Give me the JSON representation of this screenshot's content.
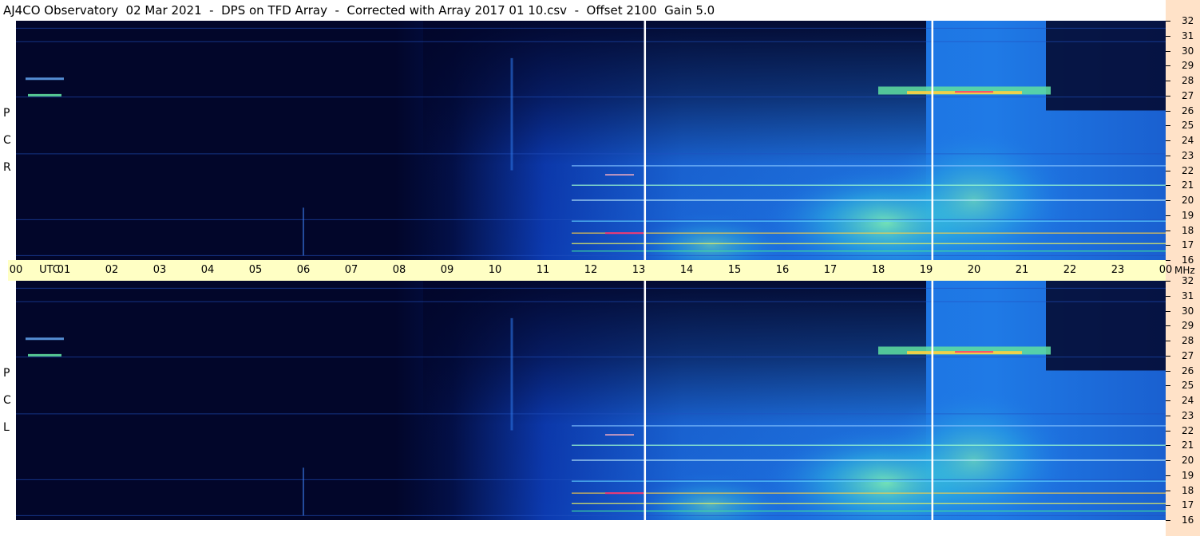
{
  "title": "AJ4CO Observatory  02 Mar 2021  -  DPS on TFD Array  -  Corrected with Array 2017 01 10.csv  -  Offset 2100  Gain 5.0",
  "chart_data": {
    "type": "heatmap",
    "panels": [
      {
        "name": "RCP",
        "polarization_letters": [
          "R",
          "C",
          "P"
        ]
      },
      {
        "name": "LCP",
        "polarization_letters": [
          "L",
          "C",
          "P"
        ]
      }
    ],
    "x_axis": {
      "labels": [
        "00",
        "UTC",
        "01",
        "02",
        "03",
        "04",
        "05",
        "06",
        "07",
        "08",
        "09",
        "10",
        "11",
        "12",
        "13",
        "14",
        "15",
        "16",
        "17",
        "18",
        "19",
        "20",
        "21",
        "22",
        "23",
        "00"
      ],
      "hours": [
        0,
        1,
        2,
        3,
        4,
        5,
        6,
        7,
        8,
        9,
        10,
        11,
        12,
        13,
        14,
        15,
        16,
        17,
        18,
        19,
        20,
        21,
        22,
        23,
        24
      ],
      "range": [
        0,
        24
      ]
    },
    "y_axis": {
      "unit": "MHz",
      "ticks": [
        32,
        31,
        30,
        29,
        28,
        27,
        26,
        25,
        24,
        23,
        22,
        21,
        20,
        19,
        18,
        17,
        16
      ],
      "range": [
        16,
        32
      ]
    },
    "markers_utc": [
      13.13,
      19.13
    ],
    "colors": {
      "background": "#02062a",
      "low": "#0a2a90",
      "mid": "#1e78e6",
      "high": "#40e0a0",
      "peak": "#ff3a6e",
      "marker": "#ffffff"
    }
  }
}
